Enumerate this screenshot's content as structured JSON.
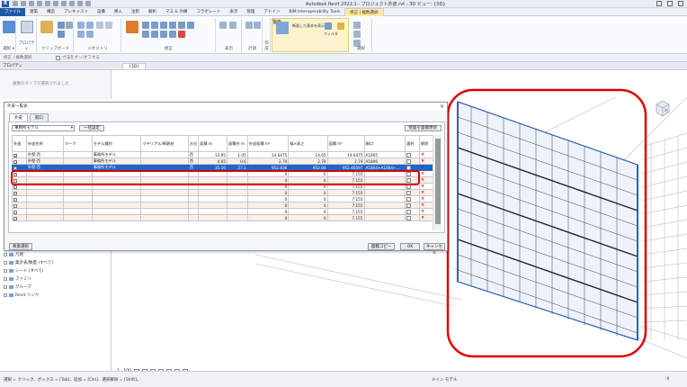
{
  "app": {
    "title": "Autodesk Revit 2022.1 - プロジェクト外皮.rvt - 3D ビュー: {3D}",
    "icon_label": "R"
  },
  "ribbon_tabs": [
    "ファイル",
    "建築",
    "構造",
    "プレキャスト",
    "設備",
    "挿入",
    "注釈",
    "解析",
    "マス & 外構",
    "コラボレート",
    "表示",
    "管理",
    "アドイン",
    "BIM Interoperability Tools",
    "修正 | 複数選択"
  ],
  "ribbon_groups": {
    "select": "選択 ▾",
    "properties": "プロパティ",
    "clipboard": "クリップボード",
    "geometry": "ジオメトリ",
    "modify": "修正",
    "view": "表示",
    "measure": "計測",
    "create": "作成",
    "ctx": "選択",
    "ctx_label": "断面した基本を表示",
    "filter": "フィルタ",
    "warning": "警告"
  },
  "options_bar": {
    "modify": "修正 | 複数選択",
    "check_label": "寸法をオン/オフする"
  },
  "properties": {
    "header": "プロパティ",
    "message": "複数のタイプが選択されました"
  },
  "view_tab": "{3D}",
  "dialog": {
    "title": "外皮一覧表",
    "tabs": [
      "外皮",
      "開口"
    ],
    "filter_value": "事務所モデル",
    "btn_bulk": "一括設定",
    "btn_update": "壁面を面積更新",
    "headers": [
      "外皮",
      "外皮名称",
      "マーク",
      "モデル種別",
      "マテリアル/断熱材",
      "方位",
      "面積\nm",
      "面積合\nm",
      "外皮面積\nm²",
      "幅×高さ",
      "面積\nm²",
      "開口",
      "選択",
      "解除"
    ],
    "rows": [
      {
        "check": true,
        "name": "外壁-西",
        "mark": "",
        "model": "事務所モデル",
        "mat": "",
        "dir": "西",
        "a": "13.95",
        "b": "1.05",
        "c": "14.6475",
        "d": "14.65",
        "e": "14.6475",
        "open": "A1805",
        "kind": "odd"
      },
      {
        "check": true,
        "name": "外壁-西",
        "mark": "",
        "model": "事務所モデル",
        "mat": "",
        "dir": "西",
        "a": "4.65",
        "b": "0.6",
        "c": "2.79",
        "d": "2.79",
        "e": "2.79",
        "open": "A1806",
        "kind": "even"
      },
      {
        "check": false,
        "name": "外壁-西",
        "mark": "",
        "model": "事務所モデル",
        "mat": "",
        "dir": "西",
        "a": "35.16",
        "b": "27.1",
        "c": "952.836",
        "d": "952.84",
        "e": "952.46597",
        "open": "A1804+A1804+...",
        "kind": "sel"
      },
      {
        "check": false,
        "name": "",
        "mark": "",
        "model": "",
        "mat": "",
        "dir": "",
        "a": "",
        "b": "",
        "c": "0",
        "d": "0",
        "e": "7.155",
        "open": "",
        "kind": "odd"
      },
      {
        "check": false,
        "name": "",
        "mark": "",
        "model": "",
        "mat": "",
        "dir": "",
        "a": "",
        "b": "",
        "c": "0",
        "d": "0",
        "e": "7.155",
        "open": "",
        "kind": "even"
      },
      {
        "check": false,
        "name": "",
        "mark": "",
        "model": "",
        "mat": "",
        "dir": "",
        "a": "",
        "b": "",
        "c": "0",
        "d": "0",
        "e": "7.155",
        "open": "",
        "kind": "odd"
      },
      {
        "check": false,
        "name": "",
        "mark": "",
        "model": "",
        "mat": "",
        "dir": "",
        "a": "",
        "b": "",
        "c": "0",
        "d": "0",
        "e": "7.155",
        "open": "",
        "kind": "even"
      },
      {
        "check": false,
        "name": "",
        "mark": "",
        "model": "",
        "mat": "",
        "dir": "",
        "a": "",
        "b": "",
        "c": "0",
        "d": "0",
        "e": "7.155",
        "open": "",
        "kind": "odd"
      },
      {
        "check": false,
        "name": "",
        "mark": "",
        "model": "",
        "mat": "",
        "dir": "",
        "a": "",
        "b": "",
        "c": "0",
        "d": "0",
        "e": "7.155",
        "open": "",
        "kind": "even"
      },
      {
        "check": false,
        "name": "",
        "mark": "",
        "model": "",
        "mat": "",
        "dir": "",
        "a": "",
        "b": "",
        "c": "0",
        "d": "0",
        "e": "7.155",
        "open": "",
        "kind": "odd"
      },
      {
        "check": false,
        "name": "",
        "mark": "",
        "model": "",
        "mat": "",
        "dir": "",
        "a": "",
        "b": "",
        "c": "0",
        "d": "0",
        "e": "7.155",
        "open": "",
        "kind": "even"
      }
    ],
    "btn_select_all": "要素選択",
    "btn_copy": "面積コピー",
    "btn_ok": "OK",
    "btn_cancel": "キャンセル"
  },
  "browser": {
    "nodes": [
      "凡例",
      "集計表/数量 (すべて)",
      "シート (すべて)",
      "ファミリ",
      "グループ",
      "Revit リンク"
    ]
  },
  "view_control": {
    "scale": "1 : 100"
  },
  "status": {
    "hint": "選択 = クリック、ボックス = [Tab]、追加 = [Ctrl]、選択解除 = [Shift]。",
    "model": "メイン モデル",
    "filter_count": ":0"
  },
  "navcube": {
    "face": "右"
  },
  "colors": {
    "accent": "#1f5aa6",
    "selection": "#1c67c9",
    "highlight": "#e00000",
    "row_alt": "#fcefe7"
  }
}
